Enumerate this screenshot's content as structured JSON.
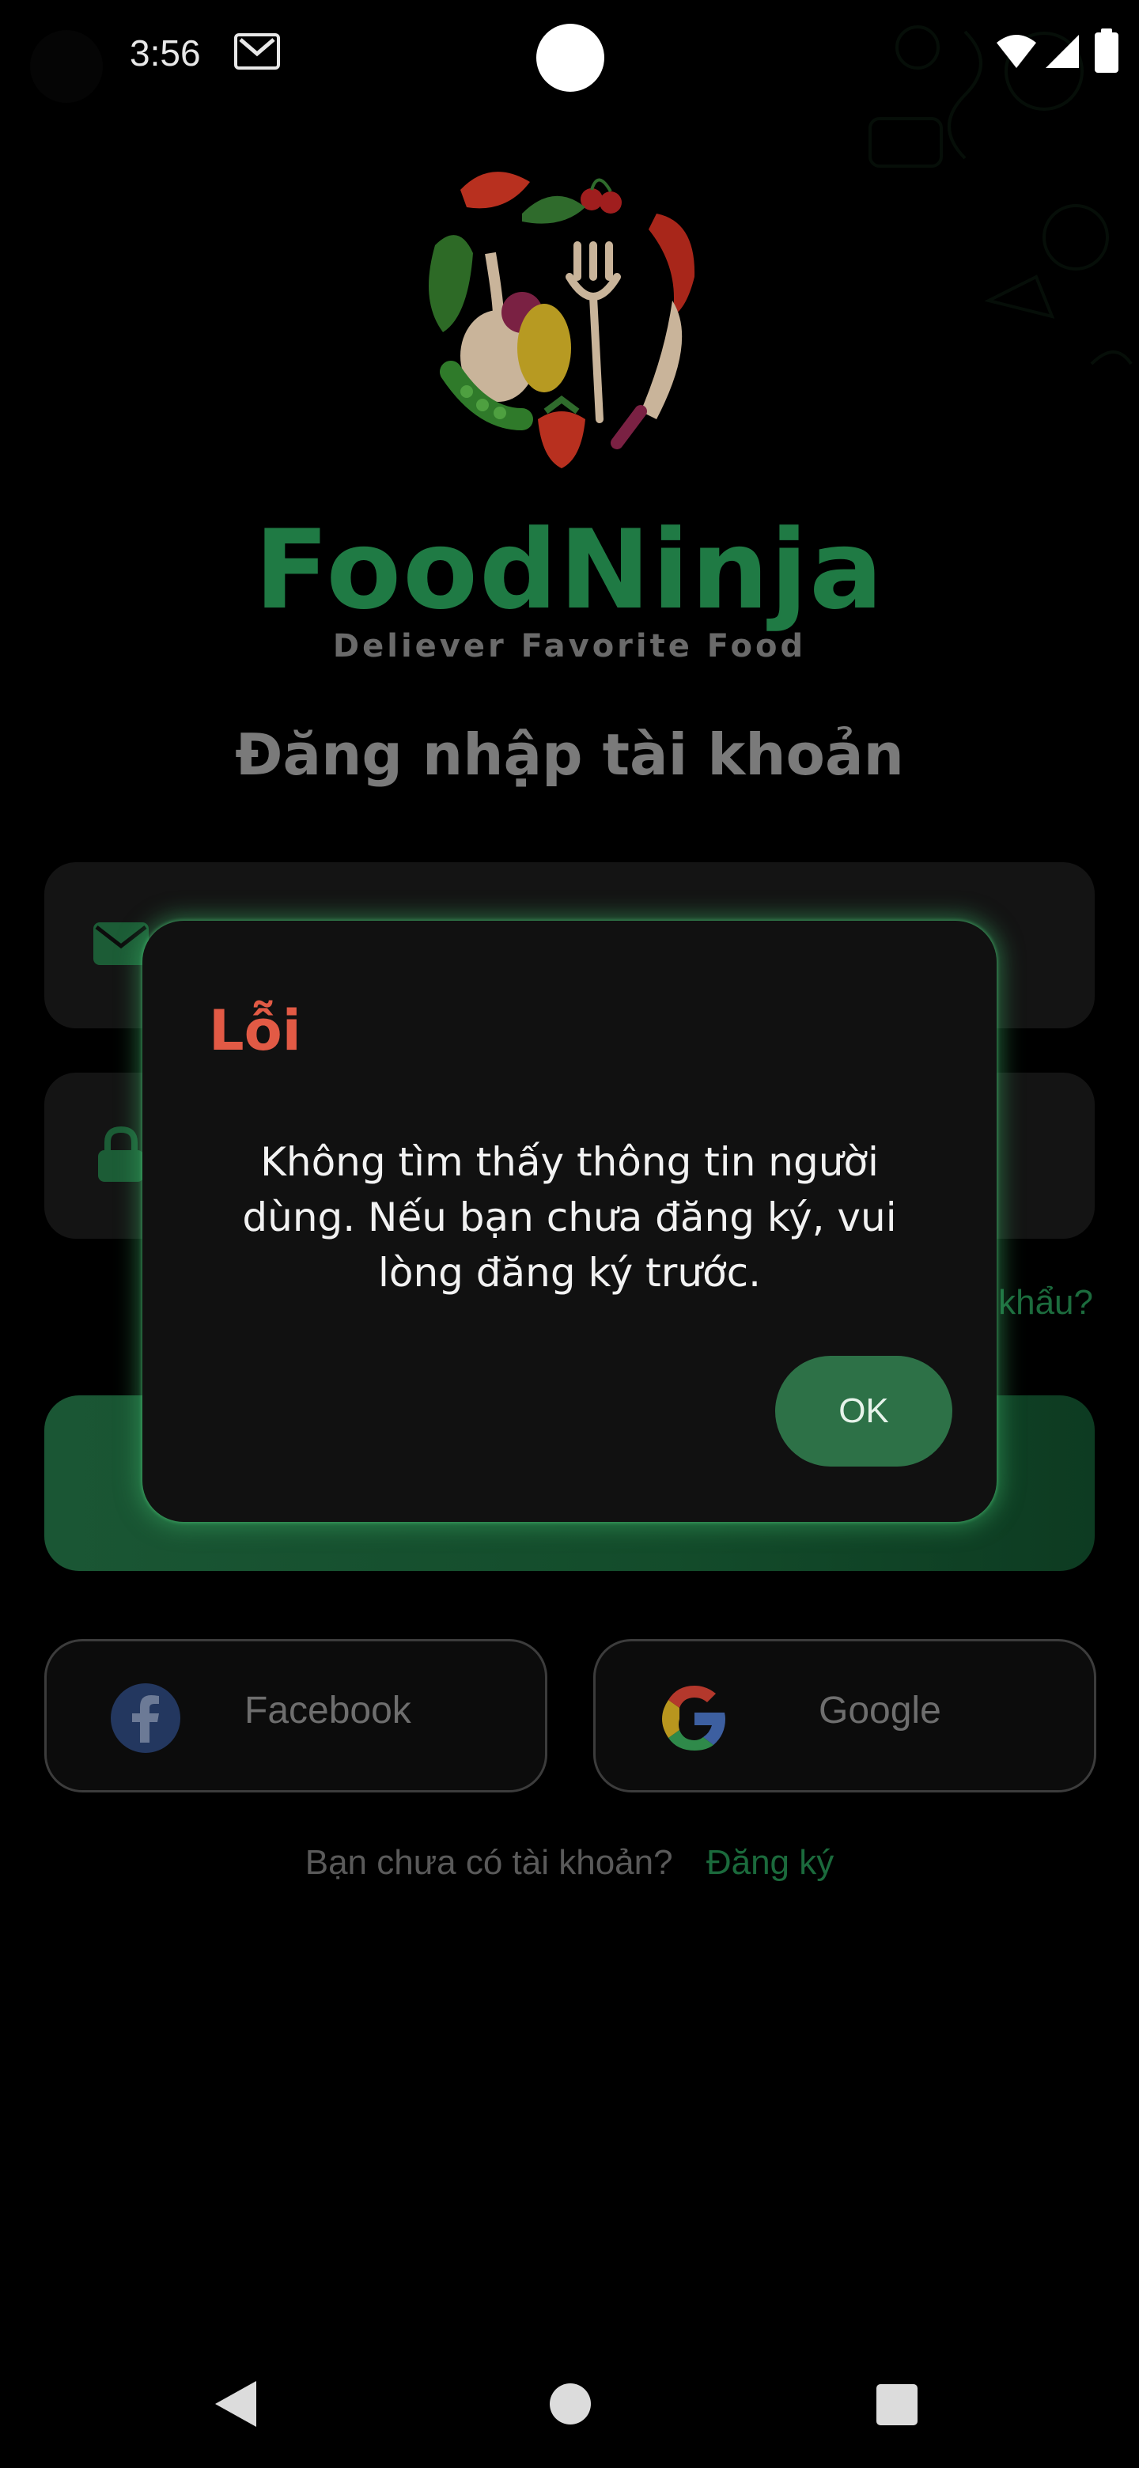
{
  "status_bar": {
    "time": "3:56"
  },
  "brand": {
    "name": "FoodNinja",
    "tagline": "Deliever Favorite Food"
  },
  "login": {
    "title": "Đăng nhập tài khoản",
    "forgot_password": "khẩu?",
    "social": {
      "facebook": "Facebook",
      "google": "Google"
    },
    "signup_prompt": "Bạn chưa có tài khoản?",
    "signup_link": "Đăng ký"
  },
  "dialog": {
    "title": "Lỗi",
    "message": "Không tìm thấy thông tin người dùng. Nếu bạn chưa đăng ký, vui lòng đăng ký trước.",
    "ok_label": "OK"
  },
  "colors": {
    "brand_green": "#1f7a44",
    "error_red": "#e25a45",
    "dialog_glow": "#3aaa64"
  }
}
